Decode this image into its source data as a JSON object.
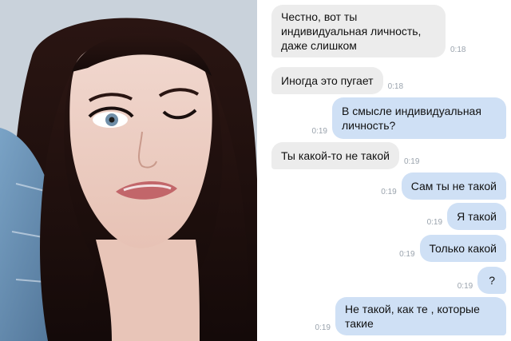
{
  "messages": [
    {
      "side": "in",
      "text": "Честно,  вот ты\nиндивидуальная личность,\nдаже слишком",
      "time": "0:18"
    },
    {
      "side": "in",
      "text": "Иногда это пугает",
      "time": "0:18"
    },
    {
      "side": "out",
      "text": "В смысле индивидуальная\nличность?",
      "time": "0:19"
    },
    {
      "side": "in",
      "text": "Ты какой-то не такой",
      "time": "0:19"
    },
    {
      "side": "out",
      "text": "Сам ты не такой",
      "time": "0:19"
    },
    {
      "side": "out",
      "text": "Я такой",
      "time": "0:19"
    },
    {
      "side": "out",
      "text": "Только какой",
      "time": "0:19"
    },
    {
      "side": "out",
      "text": "?",
      "time": "0:19"
    },
    {
      "side": "out",
      "text": "Не такой, как те , которые\nтакие",
      "time": "0:19"
    }
  ],
  "colors": {
    "incoming_bubble": "#ececec",
    "outgoing_bubble": "#cfe0f5",
    "timestamp": "#9aa3ad"
  }
}
